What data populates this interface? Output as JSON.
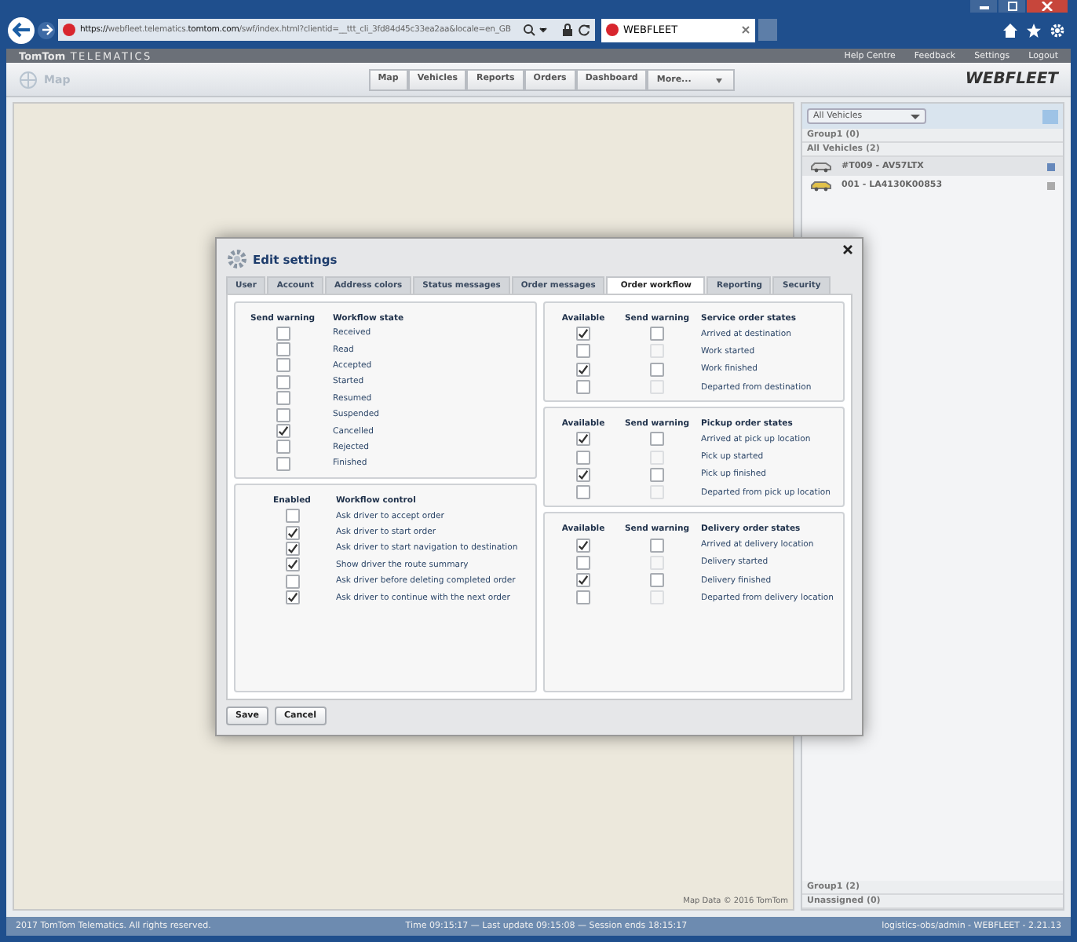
{
  "browser": {
    "url_prefix": "https://",
    "url_domain_pre": "webfleet.telematics.",
    "url_domain": "tomtom.com",
    "url_rest": "/swf/index.html?clientid=__ttt_cli_3fd84d45c33ea2aa&locale=en_GB",
    "tab_title": "WEBFLEET"
  },
  "header": {
    "brand_left": "TomTom",
    "brand_right": "TELEMATICS",
    "links": [
      "Help Centre",
      "Feedback",
      "Settings",
      "Logout"
    ]
  },
  "page_title": "Map",
  "nav": [
    {
      "label": "Map",
      "kind": "button"
    },
    {
      "label": "Vehicles",
      "kind": "button"
    },
    {
      "label": "Reports",
      "kind": "button"
    },
    {
      "label": "Orders",
      "kind": "button"
    },
    {
      "label": "Dashboard",
      "kind": "button"
    },
    {
      "label": "More...",
      "kind": "dropdown"
    }
  ],
  "logo": "WEBFLEET",
  "map": {
    "attribution": "Map Data © 2016 TomTom"
  },
  "sidebar": {
    "filter": "All Vehicles",
    "groups_top": [
      "Group1 (0)",
      "All Vehicles (2)"
    ],
    "vehicles": [
      {
        "name": "#T009 - AV57LTX",
        "selected": true
      },
      {
        "name": "001 - LA4130K00853",
        "selected": false
      }
    ],
    "groups_bottom": [
      "Group1 (2)",
      "Unassigned (0)"
    ]
  },
  "dialog": {
    "title": "Edit settings",
    "tabs": [
      {
        "label": "User",
        "selected": false
      },
      {
        "label": "Account",
        "selected": false
      },
      {
        "label": "Address colors",
        "selected": false
      },
      {
        "label": "Status messages",
        "selected": false
      },
      {
        "label": "Order messages",
        "selected": false
      },
      {
        "label": "Order workflow",
        "selected": true
      },
      {
        "label": "Reporting",
        "selected": false
      },
      {
        "label": "Security",
        "selected": false
      }
    ],
    "workflow_states": {
      "headers": [
        "Send warning",
        "Workflow state"
      ],
      "rows": [
        {
          "label": "Received",
          "checked": false
        },
        {
          "label": "Read",
          "checked": false
        },
        {
          "label": "Accepted",
          "checked": false
        },
        {
          "label": "Started",
          "checked": false
        },
        {
          "label": "Resumed",
          "checked": false
        },
        {
          "label": "Suspended",
          "checked": false
        },
        {
          "label": "Cancelled",
          "checked": true
        },
        {
          "label": "Rejected",
          "checked": false
        },
        {
          "label": "Finished",
          "checked": false
        }
      ]
    },
    "workflow_control": {
      "headers": [
        "Enabled",
        "Workflow control"
      ],
      "rows": [
        {
          "label": "Ask driver to accept order",
          "checked": false
        },
        {
          "label": "Ask driver to start order",
          "checked": true
        },
        {
          "label": "Ask driver to start navigation to destination",
          "checked": true
        },
        {
          "label": "Show driver the route summary",
          "checked": true
        },
        {
          "label": "Ask driver before deleting completed order",
          "checked": false
        },
        {
          "label": "Ask driver to continue with the next order",
          "checked": true
        }
      ]
    },
    "order_state_groups": [
      {
        "headers": [
          "Available",
          "Send warning",
          "Service order states"
        ],
        "rows": [
          {
            "label": "Arrived at destination",
            "available": true,
            "send_warning": false,
            "warning_disabled": false
          },
          {
            "label": "Work started",
            "available": false,
            "send_warning": false,
            "warning_disabled": true
          },
          {
            "label": "Work finished",
            "available": true,
            "send_warning": false,
            "warning_disabled": false
          },
          {
            "label": "Departed from destination",
            "available": false,
            "send_warning": false,
            "warning_disabled": true
          }
        ]
      },
      {
        "headers": [
          "Available",
          "Send warning",
          "Pickup order states"
        ],
        "rows": [
          {
            "label": "Arrived at pick up location",
            "available": true,
            "send_warning": false,
            "warning_disabled": false
          },
          {
            "label": "Pick up started",
            "available": false,
            "send_warning": false,
            "warning_disabled": true
          },
          {
            "label": "Pick up finished",
            "available": true,
            "send_warning": false,
            "warning_disabled": false
          },
          {
            "label": "Departed from pick up location",
            "available": false,
            "send_warning": false,
            "warning_disabled": true
          }
        ]
      },
      {
        "headers": [
          "Available",
          "Send warning",
          "Delivery order states"
        ],
        "rows": [
          {
            "label": "Arrived at delivery location",
            "available": true,
            "send_warning": false,
            "warning_disabled": false
          },
          {
            "label": "Delivery started",
            "available": false,
            "send_warning": false,
            "warning_disabled": true
          },
          {
            "label": "Delivery finished",
            "available": true,
            "send_warning": false,
            "warning_disabled": false
          },
          {
            "label": "Departed from delivery location",
            "available": false,
            "send_warning": false,
            "warning_disabled": true
          }
        ]
      }
    ],
    "buttons": [
      "Save",
      "Cancel"
    ]
  },
  "status_bar": {
    "copyright": "2017 TomTom Telematics. All rights reserved.",
    "time": "Time 09:15:17 — Last update 09:15:08 — Session ends 18:15:17",
    "user": "logistics-obs/admin - WEBFLEET - 2.21.13"
  }
}
